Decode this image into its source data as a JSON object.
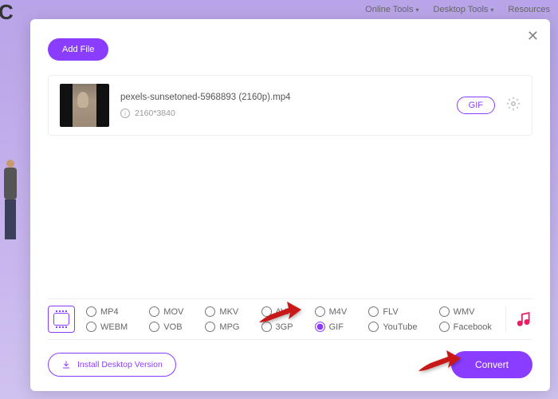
{
  "backdrop": {
    "letter": "C"
  },
  "topnav": {
    "items": [
      {
        "label": "Online Tools"
      },
      {
        "label": "Desktop Tools"
      },
      {
        "label": "Resources"
      }
    ]
  },
  "modal": {
    "add_file": "Add File",
    "file": {
      "name": "pexels-sunsetoned-5968893 (2160p).mp4",
      "resolution": "2160*3840",
      "badge": "GIF"
    },
    "formats": {
      "row1": [
        "MP4",
        "MOV",
        "MKV",
        "AVI",
        "M4V",
        "FLV",
        "WMV"
      ],
      "row2": [
        "WEBM",
        "VOB",
        "MPG",
        "3GP",
        "GIF",
        "YouTube",
        "Facebook"
      ],
      "selected": "GIF"
    },
    "install": "Install Desktop Version",
    "convert": "Convert"
  }
}
